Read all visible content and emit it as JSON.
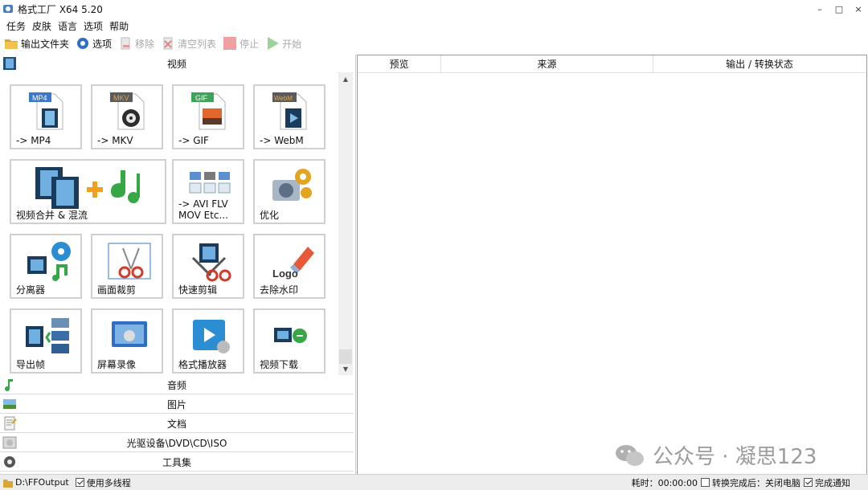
{
  "window": {
    "title": "格式工厂 X64 5.20",
    "minimize": "–",
    "maximize": "□",
    "close": "×"
  },
  "menu": [
    "任务",
    "皮肤",
    "语言",
    "选项",
    "帮助"
  ],
  "toolbar": {
    "output_folder": "输出文件夹",
    "options": "选项",
    "remove": "移除",
    "clear_list": "清空列表",
    "stop": "停止",
    "start": "开始"
  },
  "left": {
    "video_header": "视频",
    "tiles": [
      {
        "label": "-> MP4",
        "badge": "MP4",
        "badge_color": "#3a78c9"
      },
      {
        "label": "-> MKV",
        "badge": "MKV",
        "badge_color": "#5b5b5b"
      },
      {
        "label": "-> GIF",
        "badge": "GIF",
        "badge_color": "#3fa35a"
      },
      {
        "label": "-> WebM",
        "badge": "WebM",
        "badge_color": "#5a5a5a"
      },
      {
        "label": "视频合并 & 混流"
      },
      {
        "label": "-> AVI FLV\nMOV Etc..."
      },
      {
        "label": "优化"
      },
      {
        "label": "分离器"
      },
      {
        "label": "画面裁剪"
      },
      {
        "label": "快速剪辑"
      },
      {
        "label": "去除水印",
        "logo_text": "Logo"
      },
      {
        "label": "导出帧"
      },
      {
        "label": "屏幕录像"
      },
      {
        "label": "格式播放器"
      },
      {
        "label": "视频下载"
      }
    ],
    "categories": [
      "音频",
      "图片",
      "文档",
      "光驱设备\\DVD\\CD\\ISO",
      "工具集"
    ]
  },
  "right": {
    "columns": [
      "预览",
      "来源",
      "输出 / 转换状态"
    ]
  },
  "watermark": {
    "text": "公众号 · 凝思123"
  },
  "status": {
    "output_path": "D:\\FFOutput",
    "multithread": "使用多线程",
    "elapsed": "耗时：00:00:00",
    "after_convert": "转换完成后：关闭电脑",
    "notify": "完成通知"
  }
}
